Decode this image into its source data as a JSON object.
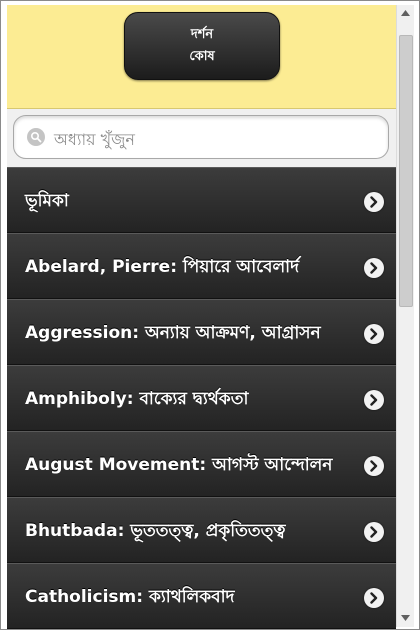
{
  "header": {
    "title_line1": "দর্শন",
    "title_line2": "কোষ"
  },
  "search": {
    "placeholder": "অধ্যায় খুঁজুন"
  },
  "items": [
    {
      "label": "ভূমিকা"
    },
    {
      "label": "Abelard, Pierre: পিয়ারে আবেলার্দ"
    },
    {
      "label": "Aggression: অন্যায় আক্রমণ, আগ্রাসন"
    },
    {
      "label": "Amphiboly: বাক্যের দ্ব্যর্থকতা"
    },
    {
      "label": "August Movement: আগস্ট আন্দোলন"
    },
    {
      "label": "Bhutbada: ভূততত্ত্ব, প্রকৃতিতত্ত্ব"
    },
    {
      "label": "Catholicism: ক্যাথলিকবাদ"
    }
  ],
  "colors": {
    "header_bg": "#fcec93",
    "list_bg": "#2c2c2c",
    "text": "#ffffff"
  },
  "icons": {
    "search": "search-icon",
    "item_arrow": "chevron-right-icon"
  }
}
